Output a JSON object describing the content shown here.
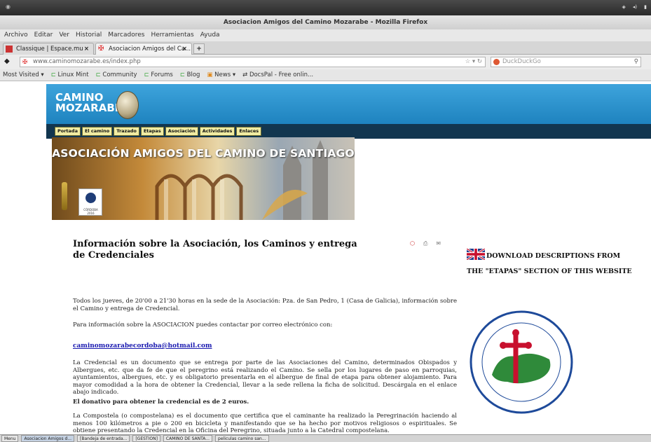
{
  "window": {
    "title": "Asociacion Amigos del Camino Mozarabe - Mozilla Firefox"
  },
  "menubar": [
    "Archivo",
    "Editar",
    "Ver",
    "Historial",
    "Marcadores",
    "Herramientas",
    "Ayuda"
  ],
  "tabs": [
    {
      "label": "Classique | Espace.mu",
      "active": false
    },
    {
      "label": "Asociacion Amigos del Ca...",
      "active": true
    }
  ],
  "navbar": {
    "url": "www.caminomozarabe.es/index.php",
    "search_placeholder": "DuckDuckGo"
  },
  "bookmarks": [
    "Most Visited ▾",
    "Linux Mint",
    "Community",
    "Forums",
    "Blog",
    "News ▾",
    "DocsPal - Free onlin..."
  ],
  "site": {
    "logo_line1": "CAMINO",
    "logo_line2": "MOZARABE",
    "nav": [
      "Portada",
      "El camino",
      "Trazado",
      "Etapas",
      "Asociación",
      "Actividades",
      "Enlaces"
    ],
    "banner_title": "ASOCIACIÓN AMIGOS DEL CAMINO DE SANTIAGO",
    "cordoba_label": "CÓRDOBA 2016"
  },
  "article": {
    "title": "Información sobre la Asociación, los Caminos y entrega de Credenciales",
    "p1": "Todos los jueves, de 20'00 a 21'30 horas en la sede de la Asociación: Pza. de San Pedro, 1 (Casa de Galicia), información sobre el Camino y entrega de Credencial.",
    "p2": "Para información sobre la ASOCIACION puedes contactar por correo electrónico con:",
    "email": "caminomozarabecordoba@hotmail.com",
    "p3": "La Credencial es un documento que se entrega por parte de las Asociaciones del Camino, determinados Obispados y Albergues, etc. que da fe de que el peregrino está realizando el Camino. Se sella por los lugares de paso en parroquias, ayuntamientos, albergues, etc. y es obligatorio presentarla en el albergue de final de etapa para obtener alojamiento. Para mayor comodidad a la hora de obtener la Credencial, llevar a la sede rellena la ficha de solicitud. Descárgala en el enlace abajo indicado.",
    "p4": "El donativo para obtener la credencial es de 2 euros.",
    "p5": "La Compostela (o compostelana) es el documento que certifica que el caminante ha realizado la Peregrinación haciendo al menos 100 kilómetros a pie o 200 en bicicleta y manifestando que se ha hecho por motivos religiosos o espirituales. Se obtiene presentando la Credencial en la Oficina del Peregrino, situada junto a la Catedral compostelana."
  },
  "sidebar": {
    "download_line1": "DOWNLOAD DESCRIPTIONS FROM",
    "download_line2": "THE \"ETAPAS\" SECTION OF THIS WEBSITE",
    "federation_text": "FEDERACION ANDALUZA DE AMIGOS DEL CAMINO DE SANTIAGO"
  },
  "taskbar": [
    "Menu",
    "Asociacion Amigos d...",
    "[Bandeja de entrada...",
    "[GESTION]",
    "CAMINO DE SANTA...",
    "peliculas camino san..."
  ],
  "colors": {
    "header_blue": "#1e83bf",
    "nav_dark": "#12364f",
    "link": "#1a1ab0"
  }
}
